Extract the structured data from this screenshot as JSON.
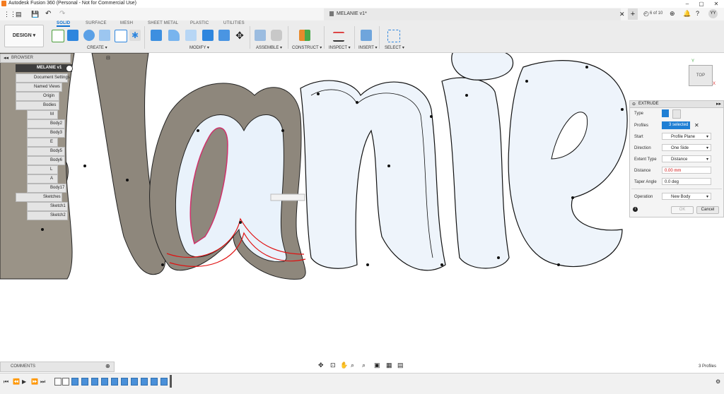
{
  "titlebar": {
    "title": "Autodesk Fusion 360 (Personal - Not for Commercial Use)"
  },
  "document": {
    "tab_title": "MELANIE v1*",
    "page_count": "6 of 10",
    "user_initials": "YY"
  },
  "workspace": {
    "label": "DESIGN"
  },
  "ribbon": {
    "tabs": [
      "SOLID",
      "SURFACE",
      "MESH",
      "SHEET METAL",
      "PLASTIC",
      "UTILITIES"
    ],
    "groups": {
      "create": "CREATE",
      "modify": "MODIFY",
      "assemble": "ASSEMBLE",
      "construct": "CONSTRUCT",
      "inspect": "INSPECT",
      "insert": "INSERT",
      "select": "SELECT"
    }
  },
  "browser": {
    "title": "BROWSER",
    "root": "MELANIE v1",
    "items": {
      "doc_settings": "Document Settings",
      "named_views": "Named Views",
      "origin": "Origin",
      "bodies": "Bodies",
      "b1": "M",
      "b2": "Body2",
      "b3": "Body3",
      "b4": "E",
      "b5": "Body5",
      "b6": "Body6",
      "b7": "L",
      "b8": "A",
      "b9": "Body17",
      "sketches": "Sketches",
      "s1": "Sketch1",
      "s2": "Sketch2"
    }
  },
  "viewcube": {
    "face": "TOP",
    "axis_x": "X",
    "axis_y": "Y"
  },
  "extrude": {
    "title": "EXTRUDE",
    "type_label": "Type",
    "profiles_label": "Profiles",
    "profiles_value": "3 selected",
    "start_label": "Start",
    "start_value": "Profile Plane",
    "direction_label": "Direction",
    "direction_value": "One Side",
    "extent_label": "Extent Type",
    "extent_value": "Distance",
    "distance_label": "Distance",
    "distance_value": "0.00 mm",
    "taper_label": "Taper Angle",
    "taper_value": "0.0 deg",
    "operation_label": "Operation",
    "operation_value": "New Body",
    "ok": "OK",
    "cancel": "Cancel"
  },
  "comments": {
    "label": "COMMENTS"
  },
  "status": {
    "selection": "3 Profiles"
  },
  "colors": {
    "accent": "#0a6fd1",
    "selected_profile": "#d9ecfb",
    "body_fill": "#8e877c",
    "sketch_red": "#e01010"
  }
}
